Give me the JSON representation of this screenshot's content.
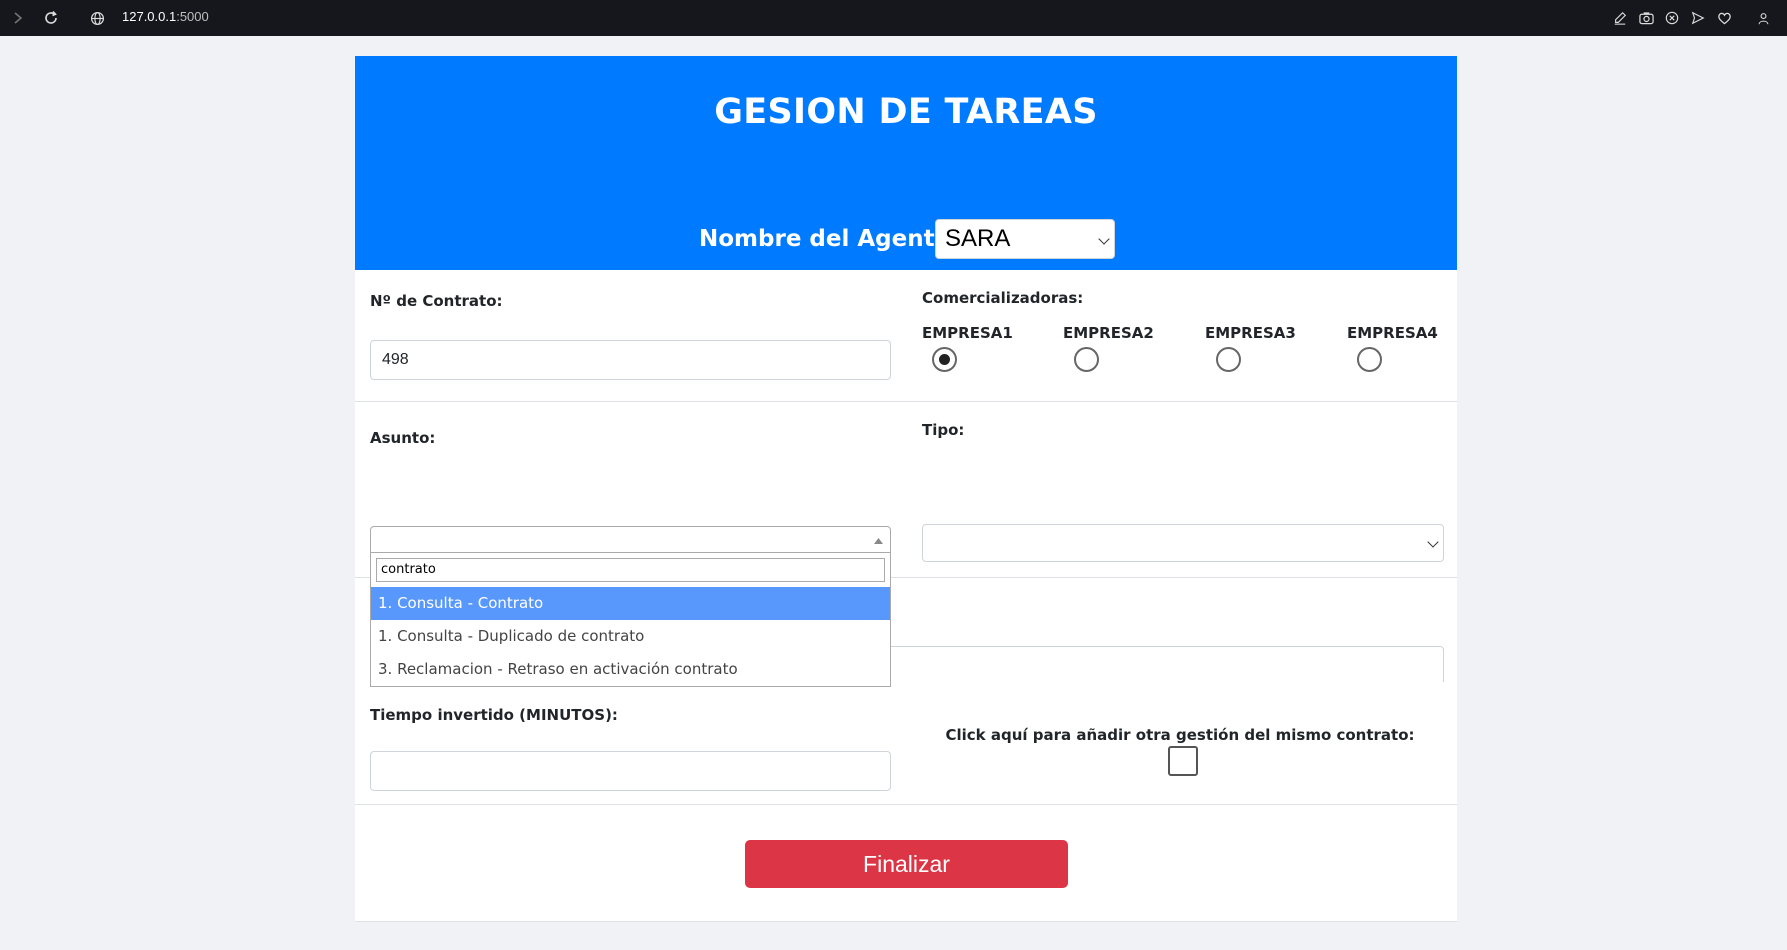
{
  "browser": {
    "url_host": "127.0.0.1",
    "url_port": ":5000"
  },
  "header": {
    "title": "GESION DE TAREAS",
    "agent_label": "Nombre del Agente:",
    "agent_value": "SARA"
  },
  "contrato": {
    "label": "Nº de Contrato:",
    "value": "498"
  },
  "comercializadoras": {
    "label": "Comercializadoras:",
    "options": [
      {
        "label": "EMPRESA1",
        "selected": true
      },
      {
        "label": "EMPRESA2",
        "selected": false
      },
      {
        "label": "EMPRESA3",
        "selected": false
      },
      {
        "label": "EMPRESA4",
        "selected": false
      }
    ]
  },
  "asunto": {
    "label": "Asunto:",
    "value": "",
    "search_text": "contrato",
    "options": [
      "1. Consulta - Contrato",
      "1. Consulta - Duplicado de contrato",
      "3. Reclamacion - Retraso en activación contrato"
    ],
    "highlighted_index": 0
  },
  "tipo": {
    "label": "Tipo:",
    "value": ""
  },
  "tiempo": {
    "label": "Tiempo invertido (MINUTOS):",
    "value": ""
  },
  "otra_gestion": {
    "label": "Click aquí para añadir otra gestión del mismo contrato:",
    "checked": false
  },
  "finalizar": {
    "label": "Finalizar"
  },
  "colors": {
    "header": "#007bff",
    "button": "#dc3545",
    "highlight": "#5897fb"
  }
}
